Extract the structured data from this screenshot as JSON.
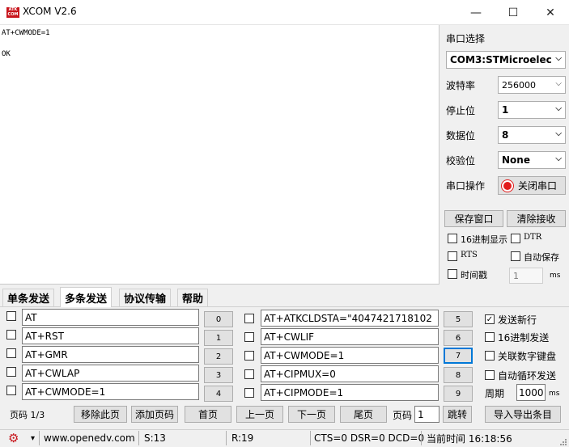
{
  "window": {
    "title": "XCOM V2.6",
    "icon_text": "ATK\nCOM",
    "minimize": "—",
    "maximize": "☐",
    "close": "✕"
  },
  "receive": {
    "text": "AT+CWMODE=1\n\nOK"
  },
  "serial": {
    "port_label": "串口选择",
    "port_value": "COM3:STMicroelec",
    "baud_label": "波特率",
    "baud_value": "256000",
    "stop_label": "停止位",
    "stop_value": "1",
    "data_label": "数据位",
    "data_value": "8",
    "parity_label": "校验位",
    "parity_value": "None",
    "op_label": "串口操作",
    "op_button": "关闭串口"
  },
  "recv_controls": {
    "save_window": "保存窗口",
    "clear_recv": "清除接收",
    "hex_display": "16进制显示",
    "dtr": "DTR",
    "rts": "RTS",
    "auto_save": "自动保存",
    "timestamp": "时间戳",
    "timestamp_value": "1",
    "ms": "ms"
  },
  "tabs": [
    "单条发送",
    "多条发送",
    "协议传输",
    "帮助"
  ],
  "multisend": {
    "left": [
      {
        "text": "AT",
        "num": "0"
      },
      {
        "text": "AT+RST",
        "num": "1"
      },
      {
        "text": "AT+GMR",
        "num": "2"
      },
      {
        "text": "AT+CWLAP",
        "num": "3"
      },
      {
        "text": "AT+CWMODE=1",
        "num": "4"
      }
    ],
    "right": [
      {
        "text": "AT+ATKCLDSTA=\"4047421718102",
        "num": "5"
      },
      {
        "text": "AT+CWLIF",
        "num": "6"
      },
      {
        "text": "AT+CWMODE=1",
        "num": "7"
      },
      {
        "text": "AT+CIPMUX=0",
        "num": "8"
      },
      {
        "text": "AT+CIPMODE=1",
        "num": "9"
      }
    ],
    "options": {
      "send_newline": "发送新行",
      "hex_send": "16进制发送",
      "link_keypad": "关联数字键盘",
      "auto_loop": "自动循环发送",
      "period_label": "周期",
      "period_value": "1000",
      "ms": "ms"
    },
    "pager": {
      "page_label": "页码 1/3",
      "remove_page": "移除此页",
      "add_page": "添加页码",
      "first": "首页",
      "prev": "上一页",
      "next": "下一页",
      "last": "尾页",
      "page_field_label": "页码",
      "page_field_value": "1",
      "jump": "跳转",
      "import_export": "导入导出条目"
    }
  },
  "status": {
    "gear": "⚙",
    "arrow": "▾",
    "url": "www.openedv.com",
    "sent": "S:13",
    "received": "R:19",
    "lines": "CTS=0 DSR=0 DCD=0",
    "time": "当前时间 16:18:56"
  },
  "colors": {
    "accent": "#0078d7",
    "brand_red": "#c8161d"
  }
}
